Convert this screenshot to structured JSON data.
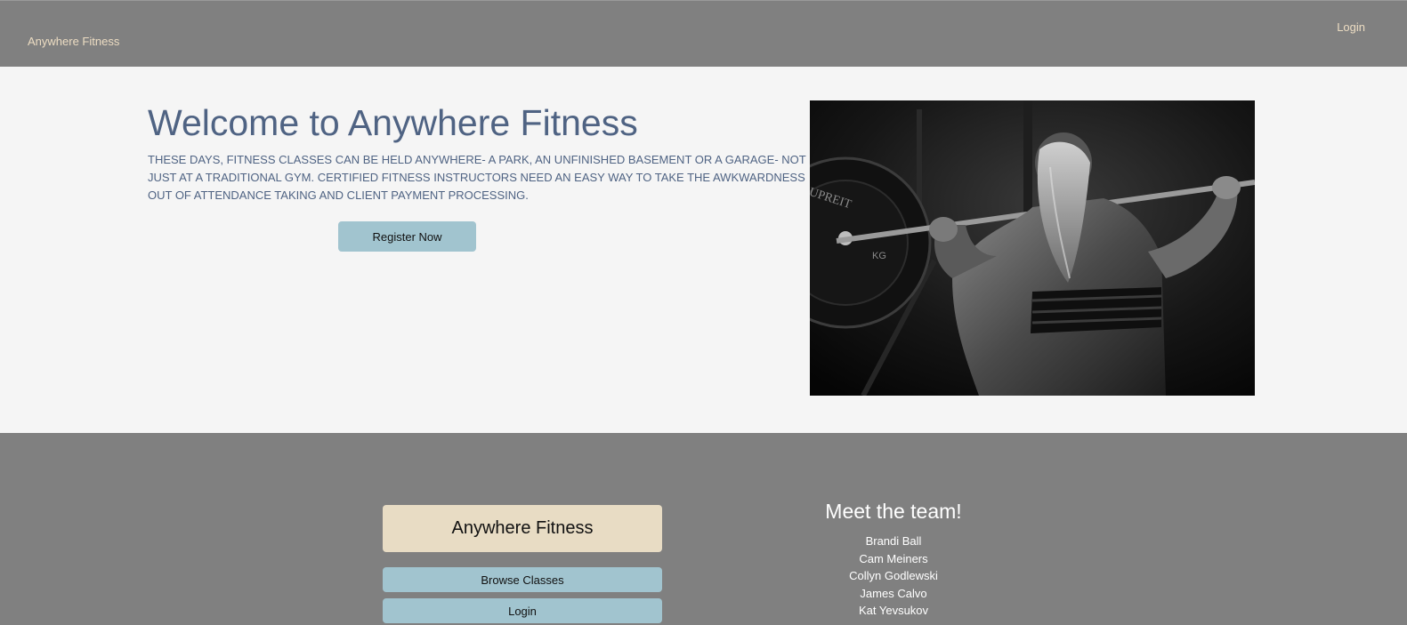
{
  "nav": {
    "brand": "Anywhere Fitness",
    "login": "Login"
  },
  "hero": {
    "title": "Welcome to Anywhere Fitness",
    "description": "These days, fitness classes can be held anywhere- a park, an unfinished basement or a garage- not just at a traditional gym. Certified fitness instructors need an easy way to take the awkwardness out of attendance taking and client payment processing.",
    "register_label": "Register Now",
    "image_icon": "weightlifter-photo"
  },
  "footer": {
    "brand": "Anywhere Fitness",
    "browse_label": "Browse Classes",
    "login_label": "Login",
    "team_title": "Meet the team!",
    "team": [
      "Brandi Ball",
      "Cam Meiners",
      "Collyn Godlewski",
      "James Calvo",
      "Kat Yevsukov"
    ]
  },
  "colors": {
    "nav_bg": "#808080",
    "brand_text": "#ecdcc2",
    "hero_text": "#4f6383",
    "button_bg": "#a1c4cf",
    "footer_brand_bg": "#e8dcc4"
  }
}
